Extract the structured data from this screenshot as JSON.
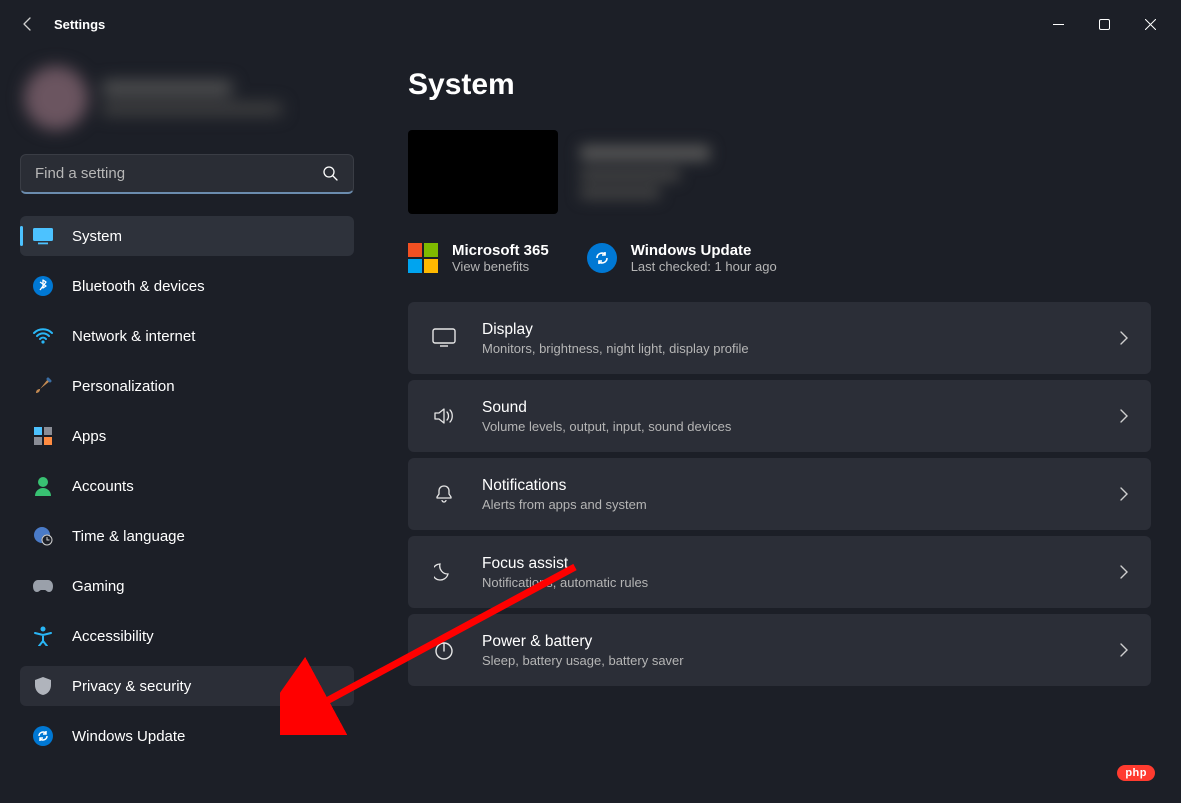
{
  "window": {
    "title": "Settings"
  },
  "search": {
    "placeholder": "Find a setting"
  },
  "sidebar": {
    "items": [
      {
        "label": "System"
      },
      {
        "label": "Bluetooth & devices"
      },
      {
        "label": "Network & internet"
      },
      {
        "label": "Personalization"
      },
      {
        "label": "Apps"
      },
      {
        "label": "Accounts"
      },
      {
        "label": "Time & language"
      },
      {
        "label": "Gaming"
      },
      {
        "label": "Accessibility"
      },
      {
        "label": "Privacy & security"
      },
      {
        "label": "Windows Update"
      }
    ]
  },
  "page": {
    "title": "System"
  },
  "promos": {
    "m365": {
      "title": "Microsoft 365",
      "sub": "View benefits"
    },
    "wu": {
      "title": "Windows Update",
      "sub": "Last checked: 1 hour ago"
    }
  },
  "rows": [
    {
      "title": "Display",
      "sub": "Monitors, brightness, night light, display profile"
    },
    {
      "title": "Sound",
      "sub": "Volume levels, output, input, sound devices"
    },
    {
      "title": "Notifications",
      "sub": "Alerts from apps and system"
    },
    {
      "title": "Focus assist",
      "sub": "Notifications, automatic rules"
    },
    {
      "title": "Power & battery",
      "sub": "Sleep, battery usage, battery saver"
    }
  ],
  "watermark": "php"
}
